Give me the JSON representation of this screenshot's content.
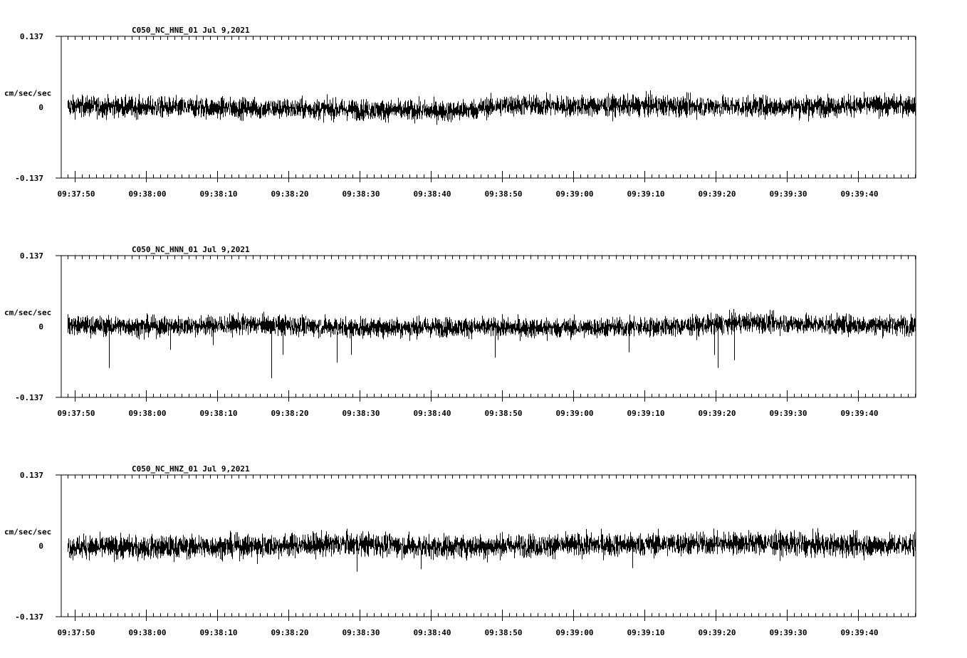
{
  "chart_data": [
    {
      "type": "line",
      "title": "C050_NC_HNE_01   Jul 9,2021",
      "station": "C050_NC_HNE_01",
      "date": "Jul 9,2021",
      "ylabel": "cm/sec/sec",
      "ylim": [
        -0.137,
        0.137
      ],
      "ytick_labels": [
        "0.137",
        "0",
        "-0.137"
      ],
      "xlim_seconds": [
        -1.9,
        118.1
      ],
      "xtick_labels": [
        "09:37:50",
        "09:38:00",
        "09:38:10",
        "09:38:20",
        "09:38:30",
        "09:38:40",
        "09:38:50",
        "09:39:00",
        "09:39:10",
        "09:39:20",
        "09:39:30",
        "09:39:40"
      ],
      "signal_start_seconds": -1.0,
      "noise_amplitude": 0.018,
      "baseline": [
        [
          -1,
          0.002
        ],
        [
          10,
          0.0
        ],
        [
          25,
          -0.002
        ],
        [
          35,
          -0.004
        ],
        [
          45,
          -0.006
        ],
        [
          53,
          -0.008
        ],
        [
          56,
          -0.004
        ],
        [
          60,
          0.004
        ],
        [
          70,
          0.002
        ],
        [
          80,
          0.003
        ],
        [
          95,
          0.001
        ],
        [
          105,
          0.002
        ],
        [
          118,
          0.004
        ]
      ],
      "spikes": [
        [
          7,
          -0.02
        ],
        [
          26,
          -0.022
        ],
        [
          54,
          -0.025
        ],
        [
          103,
          -0.028
        ]
      ]
    },
    {
      "type": "line",
      "title": "C050_NC_HNN_01   Jul 9,2021",
      "station": "C050_NC_HNN_01",
      "date": "Jul 9,2021",
      "ylabel": "cm/sec/sec",
      "ylim": [
        -0.137,
        0.137
      ],
      "ytick_labels": [
        "0.137",
        "0",
        "-0.137"
      ],
      "xlim_seconds": [
        -1.9,
        118.1
      ],
      "xtick_labels": [
        "09:37:50",
        "09:38:00",
        "09:38:10",
        "09:38:20",
        "09:38:30",
        "09:38:40",
        "09:38:50",
        "09:39:00",
        "09:39:10",
        "09:39:20",
        "09:39:30",
        "09:39:40"
      ],
      "signal_start_seconds": -1.0,
      "noise_amplitude": 0.017,
      "baseline": [
        [
          -1,
          0.002
        ],
        [
          10,
          0.0
        ],
        [
          25,
          0.004
        ],
        [
          40,
          -0.002
        ],
        [
          50,
          -0.001
        ],
        [
          65,
          -0.003
        ],
        [
          75,
          -0.002
        ],
        [
          85,
          0.0
        ],
        [
          95,
          0.008
        ],
        [
          105,
          0.004
        ],
        [
          118,
          0.002
        ]
      ],
      "spikes": [
        [
          4.8,
          -0.08
        ],
        [
          9.7,
          -0.025
        ],
        [
          13.4,
          -0.045
        ],
        [
          19.4,
          -0.036
        ],
        [
          27.6,
          -0.1
        ],
        [
          29.2,
          -0.055
        ],
        [
          36.8,
          -0.07
        ],
        [
          38.8,
          -0.055
        ],
        [
          59.0,
          -0.06
        ],
        [
          77.8,
          -0.05
        ],
        [
          89.8,
          -0.055
        ],
        [
          90.3,
          -0.08
        ],
        [
          92.6,
          -0.065
        ],
        [
          47,
          -0.028
        ],
        [
          66.3,
          -0.028
        ]
      ]
    },
    {
      "type": "line",
      "title": "C050_NC_HNZ_01   Jul 9,2021",
      "station": "C050_NC_HNZ_01",
      "date": "Jul 9,2021",
      "ylabel": "cm/sec/sec",
      "ylim": [
        -0.137,
        0.137
      ],
      "ytick_labels": [
        "0.137",
        "0",
        "-0.137"
      ],
      "xlim_seconds": [
        -1.9,
        118.1
      ],
      "xtick_labels": [
        "09:37:50",
        "09:38:00",
        "09:38:10",
        "09:38:20",
        "09:38:30",
        "09:38:40",
        "09:38:50",
        "09:39:00",
        "09:39:10",
        "09:39:20",
        "09:39:30",
        "09:39:40"
      ],
      "signal_start_seconds": -1.0,
      "noise_amplitude": 0.02,
      "baseline": [
        [
          -1,
          -0.002
        ],
        [
          10,
          -0.003
        ],
        [
          25,
          0.0
        ],
        [
          40,
          0.004
        ],
        [
          50,
          -0.002
        ],
        [
          60,
          0.0
        ],
        [
          75,
          0.002
        ],
        [
          88,
          0.004
        ],
        [
          95,
          0.006
        ],
        [
          105,
          0.001
        ],
        [
          118,
          0.002
        ]
      ],
      "spikes": [
        [
          39.6,
          -0.05
        ],
        [
          48.6,
          -0.045
        ],
        [
          78.3,
          -0.043
        ],
        [
          57.9,
          -0.032
        ],
        [
          25.6,
          -0.035
        ]
      ]
    }
  ]
}
